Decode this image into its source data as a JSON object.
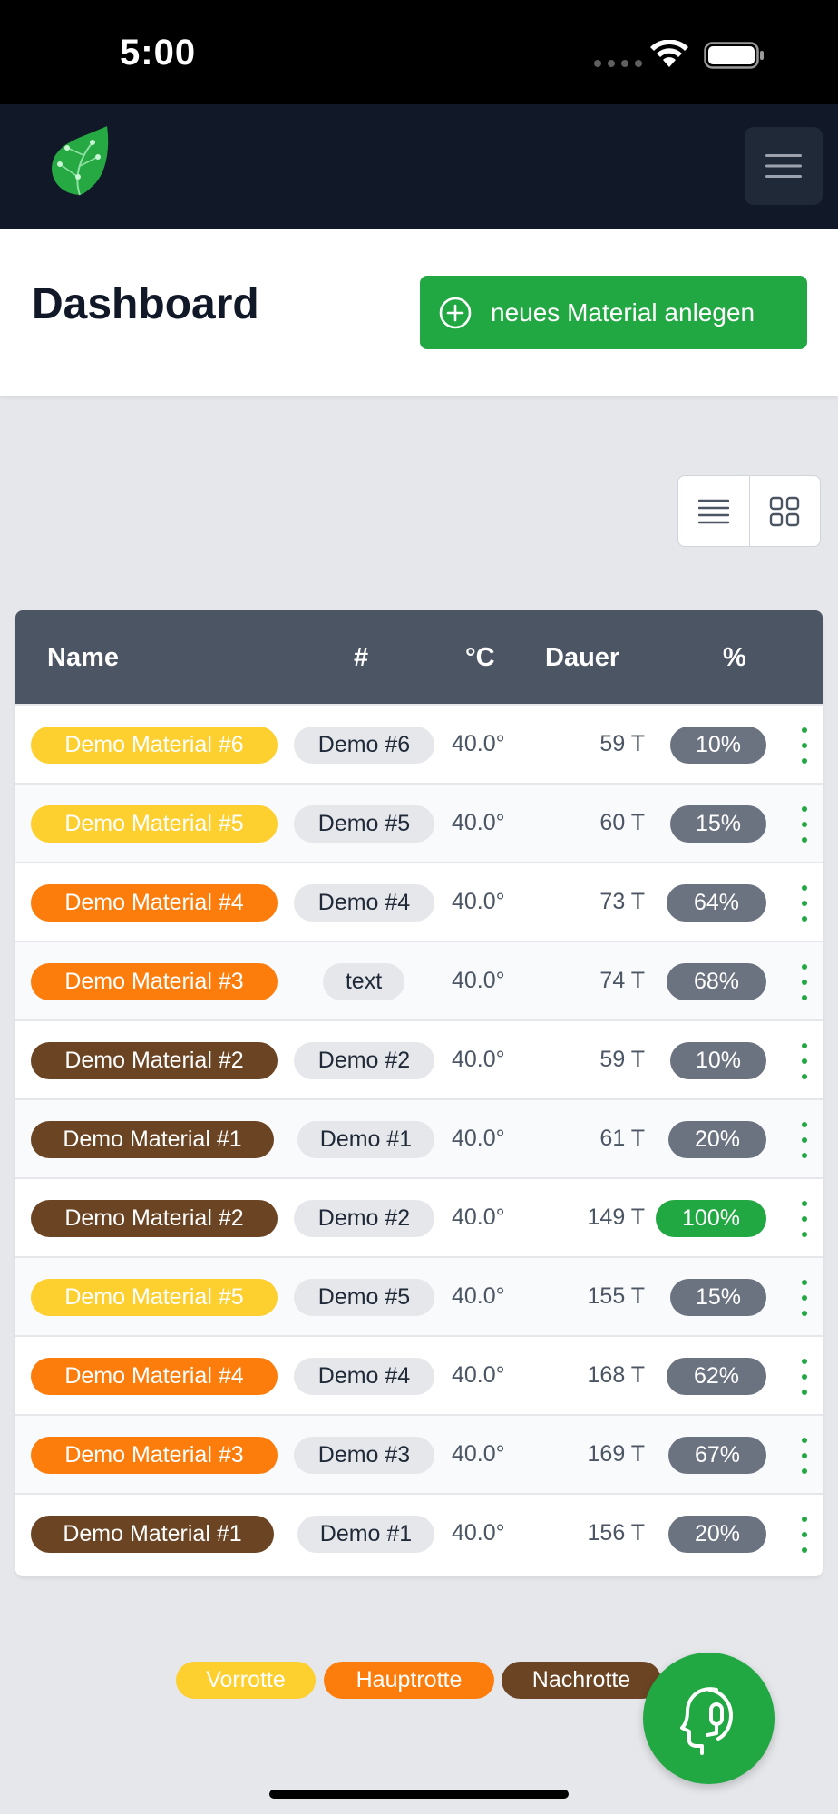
{
  "status_bar": {
    "time": "5:00"
  },
  "header": {
    "logo_icon": "leaf-logo-icon",
    "menu_icon": "hamburger-icon"
  },
  "page": {
    "title": "Dashboard",
    "new_button_label": "neues Material anlegen",
    "new_button_icon": "plus-circle-icon"
  },
  "view_toggle": {
    "list_icon": "list-view-icon",
    "grid_icon": "grid-view-icon"
  },
  "table": {
    "headers": {
      "name": "Name",
      "num": "#",
      "temp": "°C",
      "duration": "Dauer",
      "percent": "%"
    },
    "rows": [
      {
        "name": "Demo Material #6",
        "phase": "Vorrotte",
        "num": "Demo #6",
        "temp": "40.0°",
        "duration": "59 T",
        "percent": "10%"
      },
      {
        "name": "Demo Material #5",
        "phase": "Vorrotte",
        "num": "Demo #5",
        "temp": "40.0°",
        "duration": "60 T",
        "percent": "15%"
      },
      {
        "name": "Demo Material #4",
        "phase": "Hauptrotte",
        "num": "Demo #4",
        "temp": "40.0°",
        "duration": "73 T",
        "percent": "64%"
      },
      {
        "name": "Demo Material #3",
        "phase": "Hauptrotte",
        "num": "text",
        "temp": "40.0°",
        "duration": "74 T",
        "percent": "68%"
      },
      {
        "name": "Demo Material #2",
        "phase": "Nachrotte",
        "num": "Demo #2",
        "temp": "40.0°",
        "duration": "59 T",
        "percent": "10%"
      },
      {
        "name": "Demo Material #1",
        "phase": "Nachrotte",
        "num": "Demo #1",
        "temp": "40.0°",
        "duration": "61 T",
        "percent": "20%"
      },
      {
        "name": "Demo Material #2",
        "phase": "Nachrotte",
        "num": "Demo #2",
        "temp": "40.0°",
        "duration": "149 T",
        "percent": "100%"
      },
      {
        "name": "Demo Material #5",
        "phase": "Vorrotte",
        "num": "Demo #5",
        "temp": "40.0°",
        "duration": "155 T",
        "percent": "15%"
      },
      {
        "name": "Demo Material #4",
        "phase": "Hauptrotte",
        "num": "Demo #4",
        "temp": "40.0°",
        "duration": "168 T",
        "percent": "62%"
      },
      {
        "name": "Demo Material #3",
        "phase": "Hauptrotte",
        "num": "Demo #3",
        "temp": "40.0°",
        "duration": "169 T",
        "percent": "67%"
      },
      {
        "name": "Demo Material #1",
        "phase": "Nachrotte",
        "num": "Demo #1",
        "temp": "40.0°",
        "duration": "156 T",
        "percent": "20%"
      }
    ]
  },
  "legend": {
    "vorrotte": "Vorrotte",
    "hauptrotte": "Hauptrotte",
    "nachrotte": "Nachrotte"
  },
  "colors": {
    "vorrotte": "#fdcf2f",
    "hauptrotte": "#fd7d0c",
    "nachrotte": "#6b4423",
    "accent_green": "#22a843",
    "percent_default": "#6b7280",
    "percent_complete": "#22a843"
  },
  "fab": {
    "icon": "support-agent-icon"
  }
}
